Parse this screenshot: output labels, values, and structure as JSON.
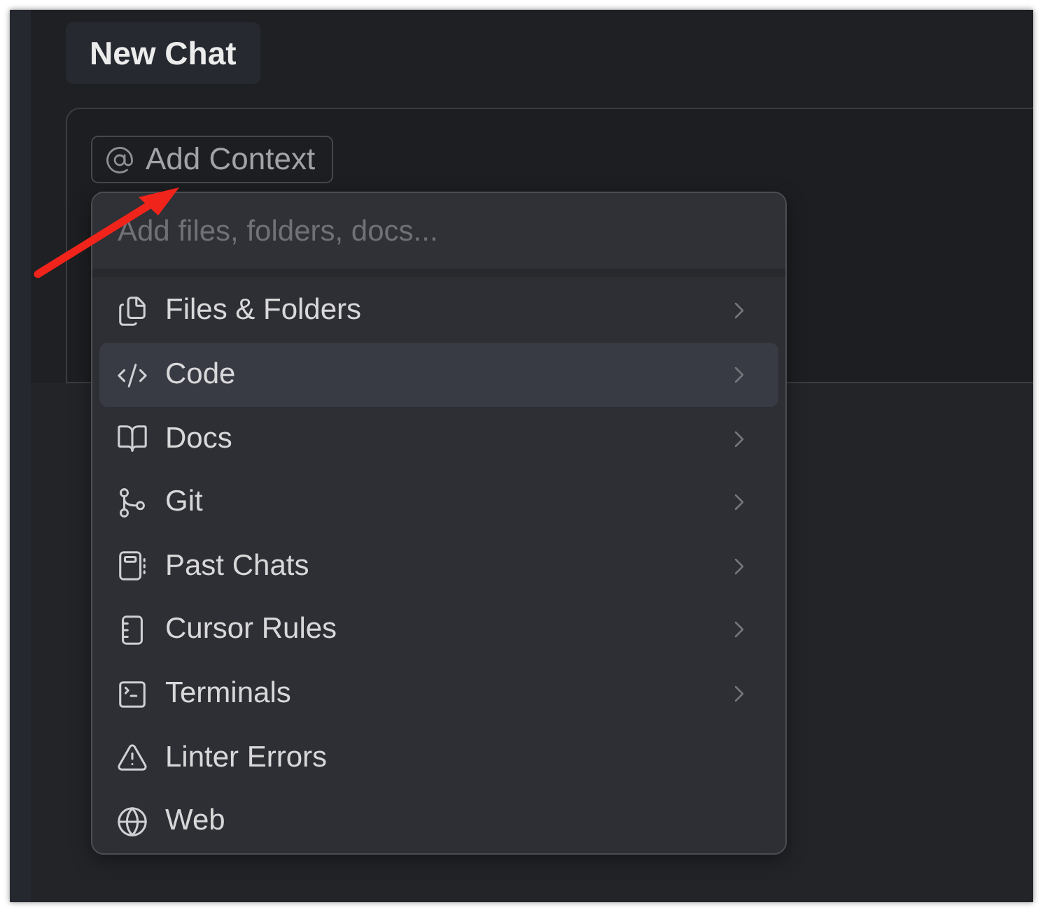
{
  "tab": {
    "label": "New Chat"
  },
  "context_button": {
    "label": "Add Context"
  },
  "context_menu": {
    "search": {
      "placeholder": "Add files, folders, docs..."
    },
    "items": [
      {
        "label": "Files & Folders",
        "selected": false,
        "has_submenu": true
      },
      {
        "label": "Code",
        "selected": true,
        "has_submenu": true
      },
      {
        "label": "Docs",
        "selected": false,
        "has_submenu": true
      },
      {
        "label": "Git",
        "selected": false,
        "has_submenu": true
      },
      {
        "label": "Past Chats",
        "selected": false,
        "has_submenu": true
      },
      {
        "label": "Cursor Rules",
        "selected": false,
        "has_submenu": true
      },
      {
        "label": "Terminals",
        "selected": false,
        "has_submenu": true
      },
      {
        "label": "Linter Errors",
        "selected": false,
        "has_submenu": false
      },
      {
        "label": "Web",
        "selected": false,
        "has_submenu": false
      }
    ]
  }
}
